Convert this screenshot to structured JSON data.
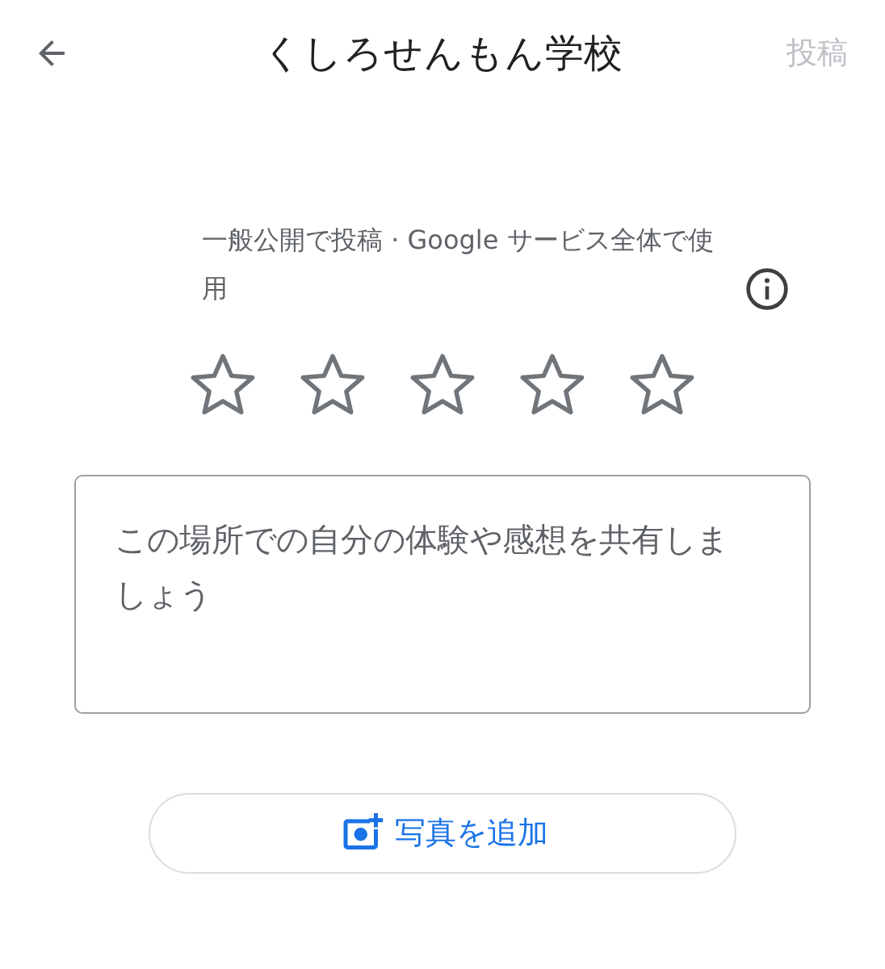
{
  "header": {
    "title": "くしろせんもん学校",
    "post_button": {
      "label": "投稿",
      "disabled": true
    }
  },
  "visibility_note": "一般公開で投稿 · Google サービス全体で使用",
  "rating": {
    "stars": 0
  },
  "review": {
    "placeholder": "この場所での自分の体験や感想を共有しましょう"
  },
  "add_photo_button": {
    "label": "写真を追加"
  }
}
